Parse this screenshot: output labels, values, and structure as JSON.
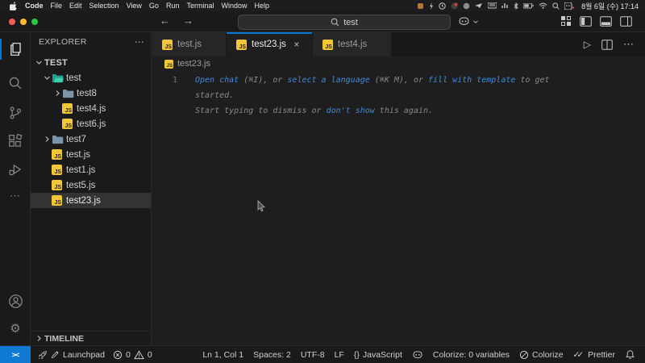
{
  "menubar": {
    "menus": [
      "Code",
      "File",
      "Edit",
      "Selection",
      "View",
      "Go",
      "Run",
      "Terminal",
      "Window",
      "Help"
    ],
    "clock": "8월 6일 (수) 17:14"
  },
  "titlebar": {
    "search": "test"
  },
  "glyphs": {
    "ellipsis": "⋯",
    "back": "←",
    "forward": "→",
    "play": "▷",
    "braces": "{}",
    "gear": "⚙",
    "remote": "><",
    "dblcheck": "✓✓"
  },
  "icons": {
    "js_label": "JS"
  },
  "sidebar": {
    "header": "EXPLORER",
    "root_label": "TEST",
    "tree": [
      {
        "label": "test"
      },
      {
        "label": "test8"
      },
      {
        "label": "test4.js"
      },
      {
        "label": "test6.js"
      },
      {
        "label": "test7"
      },
      {
        "label": "test.js"
      },
      {
        "label": "test1.js"
      },
      {
        "label": "test5.js"
      },
      {
        "label": "test23.js"
      }
    ],
    "timeline_label": "TIMELINE"
  },
  "tabs": [
    {
      "label": "test.js"
    },
    {
      "label": "test23.js",
      "close": "×"
    },
    {
      "label": "test4.js"
    }
  ],
  "breadcrumb": {
    "file": "test23.js"
  },
  "editor": {
    "line_number": "1",
    "ghost": {
      "l1s1": "Open chat",
      "l1s2": " (⌘I), or ",
      "l1s3": "select a language",
      "l1s4": " (⌘K M), or ",
      "l1s5": "fill with template",
      "l1s6": " to get",
      "l2": "started.",
      "l3s1": "Start typing to dismiss or ",
      "l3s2": "don't show",
      "l3s3": " this again."
    }
  },
  "statusbar": {
    "launchpad": "Launchpad",
    "errors": "0",
    "warnings": "0",
    "cursor": "Ln 1, Col 1",
    "indent": "Spaces: 2",
    "encoding": "UTF-8",
    "eol": "LF",
    "language": "JavaScript",
    "colorize_count": "Colorize: 0 variables",
    "colorize": "Colorize",
    "prettier": "Prettier"
  },
  "colors": {
    "accent": "#0078d4",
    "js_icon": "#f0c63a",
    "link": "#4189dd",
    "folder": "#7b94a8",
    "folder_open": "#2fbfa0"
  }
}
